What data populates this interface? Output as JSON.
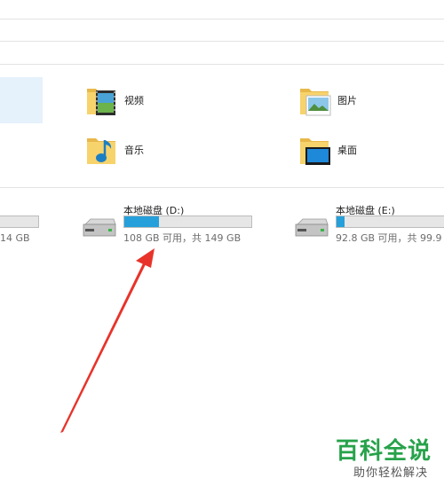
{
  "folders": {
    "videos": {
      "label": "视频",
      "icon": "video-folder-icon"
    },
    "pictures": {
      "label": "图片",
      "icon": "pictures-folder-icon"
    },
    "music": {
      "label": "音乐",
      "icon": "music-folder-icon"
    },
    "desktop": {
      "label": "桌面",
      "icon": "desktop-folder-icon"
    }
  },
  "drives": {
    "partial": {
      "space_text": "14 GB"
    },
    "d": {
      "name": "本地磁盘 (D:)",
      "space_text": "108 GB 可用，共 149 GB",
      "used_fraction": 0.275,
      "icon": "hard-drive-icon"
    },
    "e": {
      "name": "本地磁盘 (E:)",
      "space_text": "92.8 GB 可用，共 99.9",
      "used_fraction": 0.07,
      "icon": "hard-drive-icon"
    }
  },
  "colors": {
    "bar_fill": "#26a0da",
    "arrow": "#e8332a",
    "watermark_green": "#27a24a"
  },
  "watermark": {
    "title": "百科全说",
    "subtitle": "助你轻松解决"
  }
}
